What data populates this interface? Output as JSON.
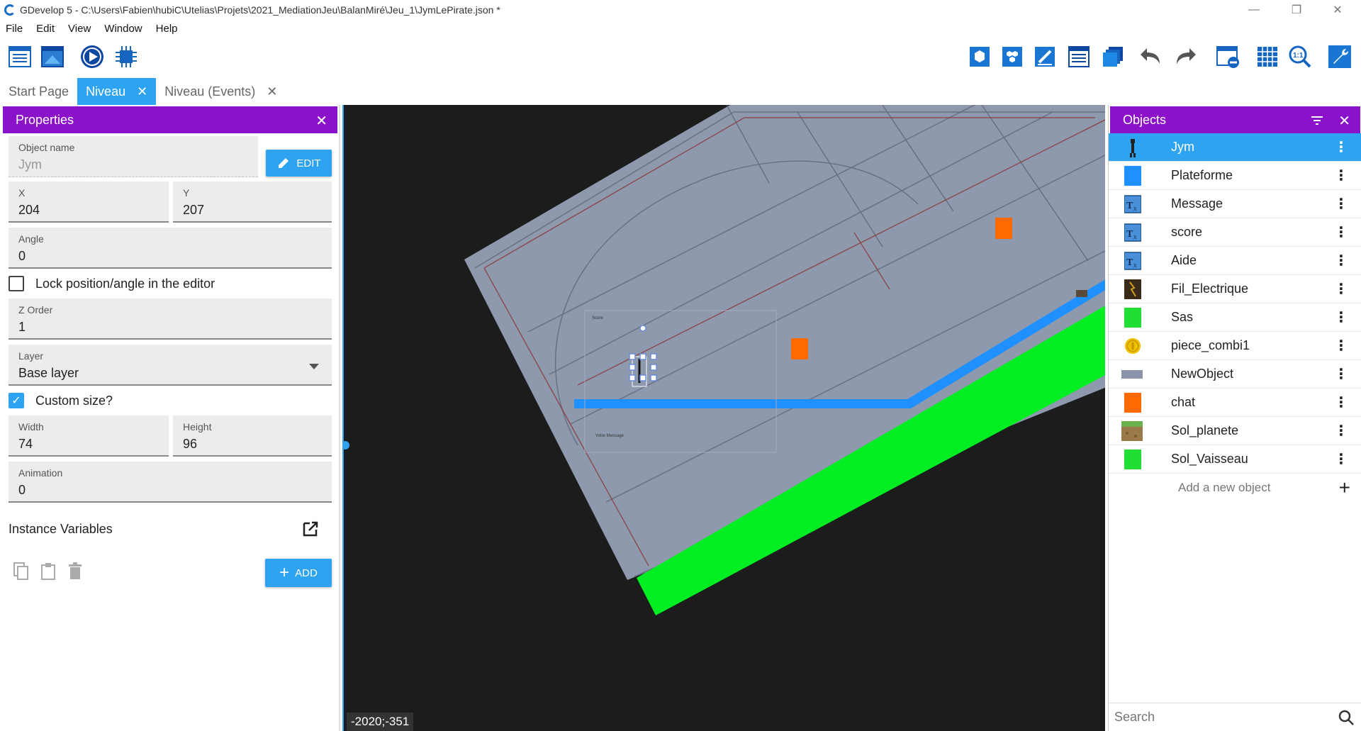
{
  "window": {
    "title": "GDevelop 5 - C:\\Users\\Fabien\\hubiC\\Utelias\\Projets\\2021_MediationJeu\\BalanMiré\\Jeu_1\\JymLePirate.json *",
    "minimize": "—",
    "restore": "❐",
    "close": "✕"
  },
  "menu": [
    "File",
    "Edit",
    "View",
    "Window",
    "Help"
  ],
  "tabs": [
    {
      "label": "Start Page",
      "closable": false
    },
    {
      "label": "Niveau",
      "closable": true,
      "close": "✕"
    },
    {
      "label": "Niveau (Events)",
      "closable": true,
      "close": "✕"
    }
  ],
  "properties": {
    "title": "Properties",
    "close": "✕",
    "object_name_label": "Object name",
    "object_name": "Jym",
    "edit_label": "EDIT",
    "x_label": "X",
    "x": "204",
    "y_label": "Y",
    "y": "207",
    "angle_label": "Angle",
    "angle": "0",
    "lock_label": "Lock position/angle in the editor",
    "zorder_label": "Z Order",
    "zorder": "1",
    "layer_label": "Layer",
    "layer": "Base layer",
    "custom_size_label": "Custom size?",
    "width_label": "Width",
    "width": "74",
    "height_label": "Height",
    "height": "96",
    "animation_label": "Animation",
    "animation": "0",
    "instance_variables_label": "Instance Variables",
    "add_label": "ADD"
  },
  "scene": {
    "coords": "-2020;-351",
    "tiny_text_1": "Score",
    "tiny_text_2": "Votre Message"
  },
  "objects": {
    "title": "Objects",
    "close": "✕",
    "items": [
      {
        "name": "Jym",
        "icon": "character-sprite-icon",
        "color": "#333333"
      },
      {
        "name": "Plateforme",
        "icon": "platform-icon",
        "color": "#1e90ff"
      },
      {
        "name": "Message",
        "icon": "text-object-icon",
        "color": "#4a90d9"
      },
      {
        "name": "score",
        "icon": "text-object-icon",
        "color": "#4a90d9"
      },
      {
        "name": "Aide",
        "icon": "text-object-icon",
        "color": "#4a90d9"
      },
      {
        "name": "Fil_Electrique",
        "icon": "electric-wire-icon",
        "color": "#6b4a2a"
      },
      {
        "name": "Sas",
        "icon": "airlock-icon",
        "color": "#22dd33"
      },
      {
        "name": "piece_combi1",
        "icon": "coin-icon",
        "color": "#f2c200"
      },
      {
        "name": "NewObject",
        "icon": "new-object-icon",
        "color": "#8a93a8"
      },
      {
        "name": "chat",
        "icon": "chat-object-icon",
        "color": "#ff6a00"
      },
      {
        "name": "Sol_planete",
        "icon": "ground-planet-icon",
        "color": "#9a7a4a"
      },
      {
        "name": "Sol_Vaisseau",
        "icon": "ground-ship-icon",
        "color": "#22dd33"
      }
    ],
    "add_new_label": "Add a new object",
    "search_placeholder": "Search"
  }
}
